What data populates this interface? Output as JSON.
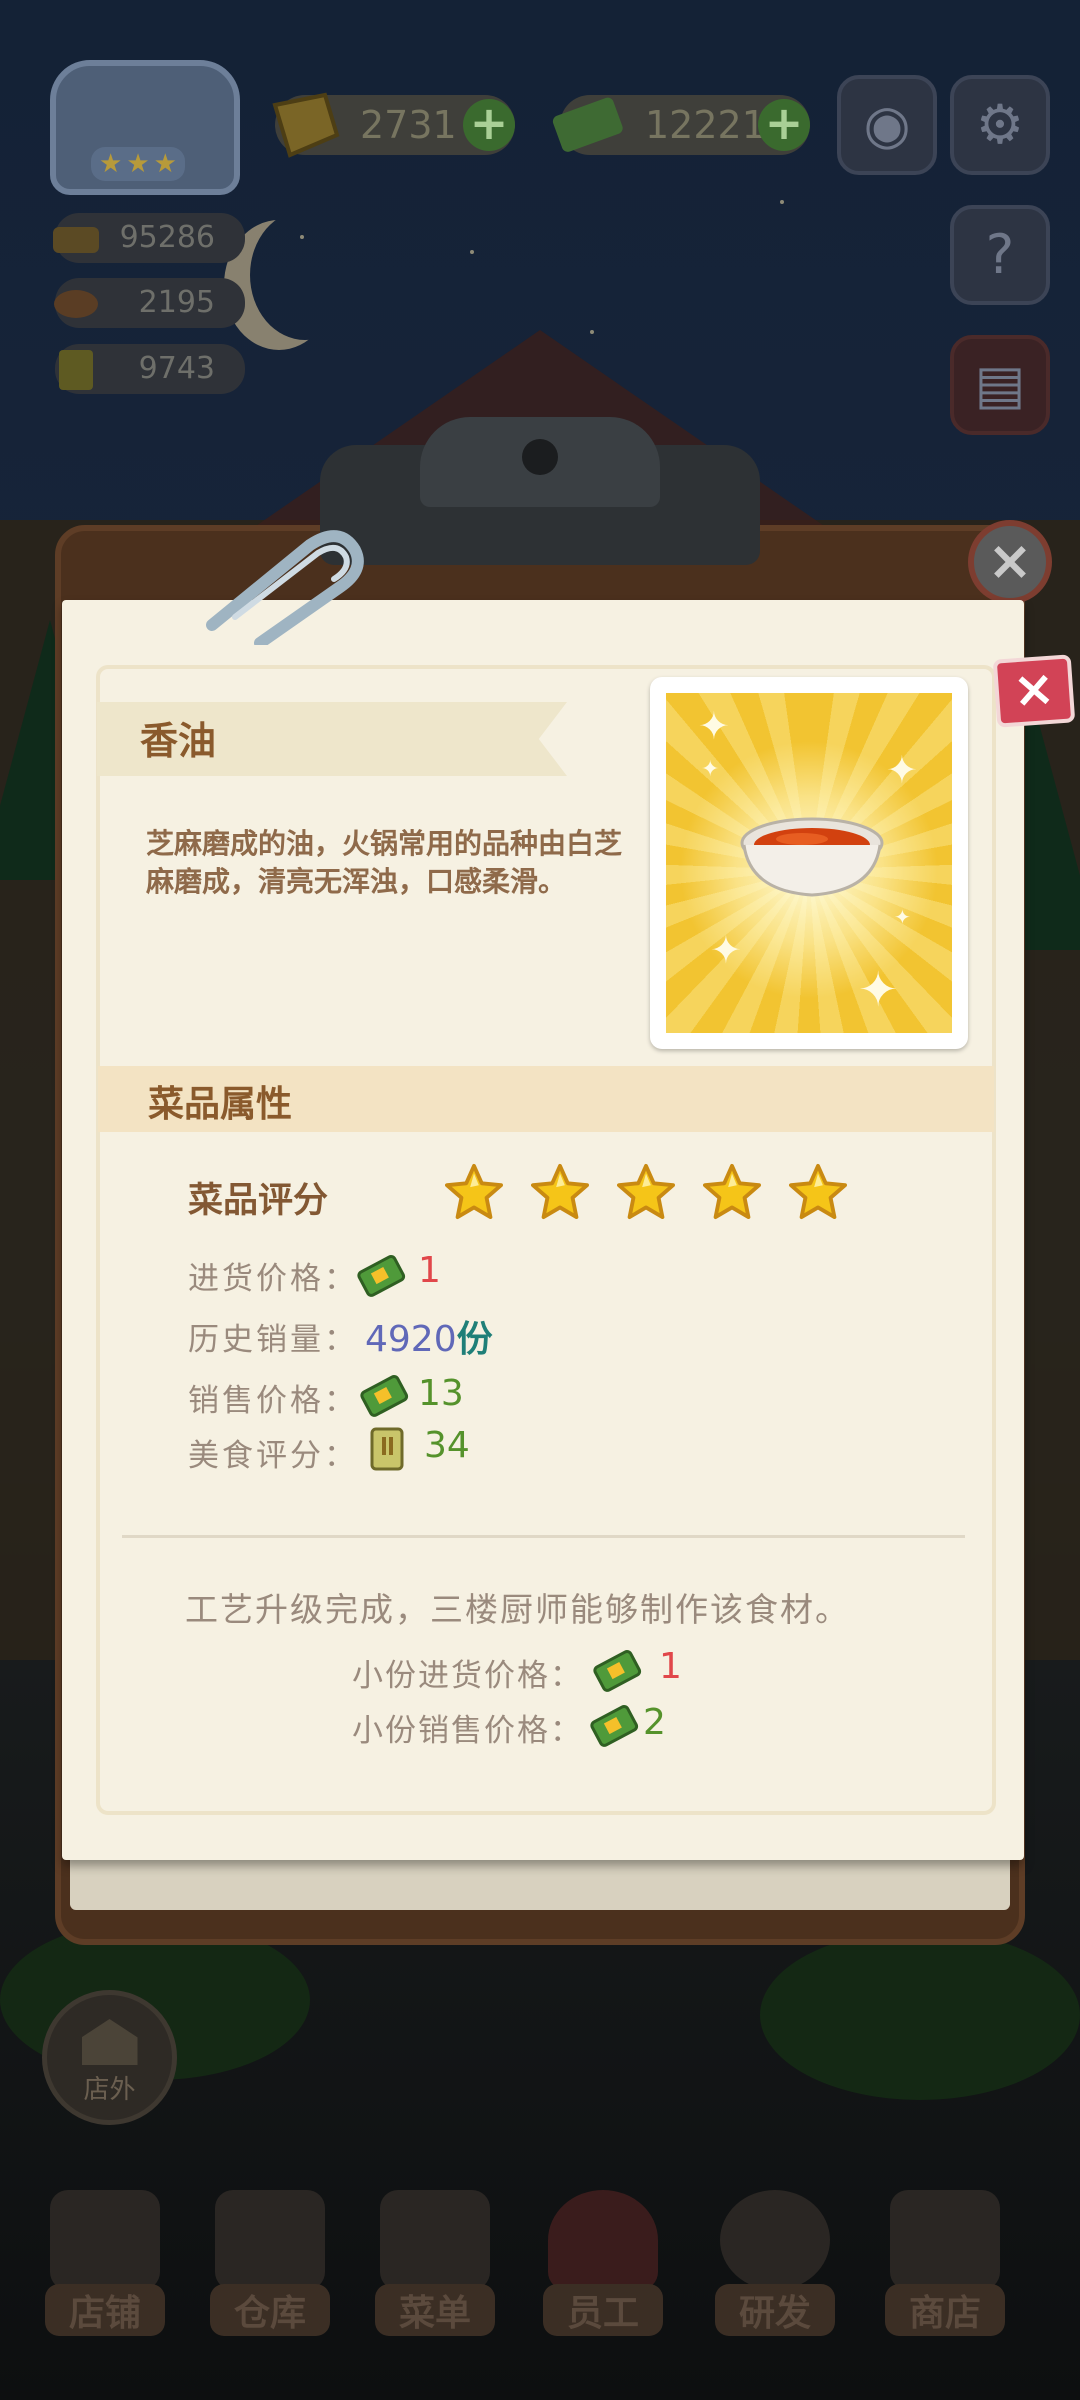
{
  "hud": {
    "gems": "2731",
    "cash": "12221",
    "plus_symbol": "+",
    "resources": [
      {
        "icon": "food-cart-icon",
        "value": "95286"
      },
      {
        "icon": "chef-hat-icon",
        "value": "2195"
      },
      {
        "icon": "recipe-book-icon",
        "value": "9743"
      }
    ],
    "camera_icon": "camera-icon",
    "settings_icon": "gear-icon",
    "help_icon": "help-book-icon",
    "notebook_icon": "notebook-icon"
  },
  "outside_button": {
    "label": "店外"
  },
  "nav": {
    "items": [
      {
        "label": "店铺",
        "icon": "shop-icon"
      },
      {
        "label": "仓库",
        "icon": "warehouse-icon"
      },
      {
        "label": "菜单",
        "icon": "menu-icon"
      },
      {
        "label": "员工",
        "icon": "staff-icon"
      },
      {
        "label": "研发",
        "icon": "research-icon"
      },
      {
        "label": "商店",
        "icon": "store-icon"
      }
    ]
  },
  "modal": {
    "close_glyph": "×",
    "item_name": "香油",
    "item_desc": "芝麻磨成的油，火锅常用的品种由白芝麻磨成，清亮无浑浊，口感柔滑。",
    "section_title": "菜品属性",
    "rating_label": "菜品评分",
    "rating_stars": 5,
    "purchase_price_label": "进货价格：",
    "purchase_price": "1",
    "sales_history_label": "历史销量：",
    "sales_history_value": "4920",
    "sales_history_unit": "份",
    "sale_price_label": "销售价格：",
    "sale_price": "13",
    "food_score_label": "美食评分：",
    "food_score": "34",
    "upgrade_text": "工艺升级完成，三楼厨师能够制作该食材。",
    "small_purchase_label": "小份进货价格：",
    "small_purchase_price": "1",
    "small_sale_label": "小份销售价格：",
    "small_sale_price": "2"
  },
  "colors": {
    "star": "#f5c518",
    "price_red": "#e1474a",
    "price_green": "#55922b",
    "sales_blue": "#6068b8",
    "close_red": "#d24356"
  }
}
